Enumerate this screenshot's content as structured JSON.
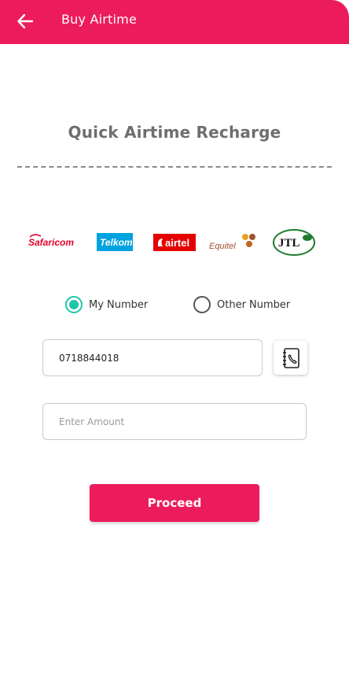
{
  "appbar": {
    "title": "Buy Airtime",
    "back_icon": "arrow-left-icon",
    "color": "#ec1c5c"
  },
  "main": {
    "title": "Quick Airtime Recharge"
  },
  "networks": [
    {
      "name": "Safaricom",
      "text": "Safaricom",
      "color": "#e4002b"
    },
    {
      "name": "Telkom",
      "text": "Telkom",
      "color": "#00a3e0"
    },
    {
      "name": "Airtel",
      "text": "airtel",
      "color": "#e40000"
    },
    {
      "name": "Equitel",
      "text": "Equitel",
      "color": "#a0522d"
    },
    {
      "name": "JTL",
      "text": "JTL",
      "color": "#1e7b2e"
    }
  ],
  "recipient": {
    "options": [
      {
        "label": "My Number",
        "selected": true
      },
      {
        "label": "Other Number",
        "selected": false
      }
    ],
    "accent": "#1fc6a9"
  },
  "phone": {
    "value": "0718844018",
    "contact_icon": "contact-book-icon"
  },
  "amount": {
    "placeholder": "Enter Amount",
    "value": ""
  },
  "actions": {
    "proceed_label": "Proceed"
  }
}
